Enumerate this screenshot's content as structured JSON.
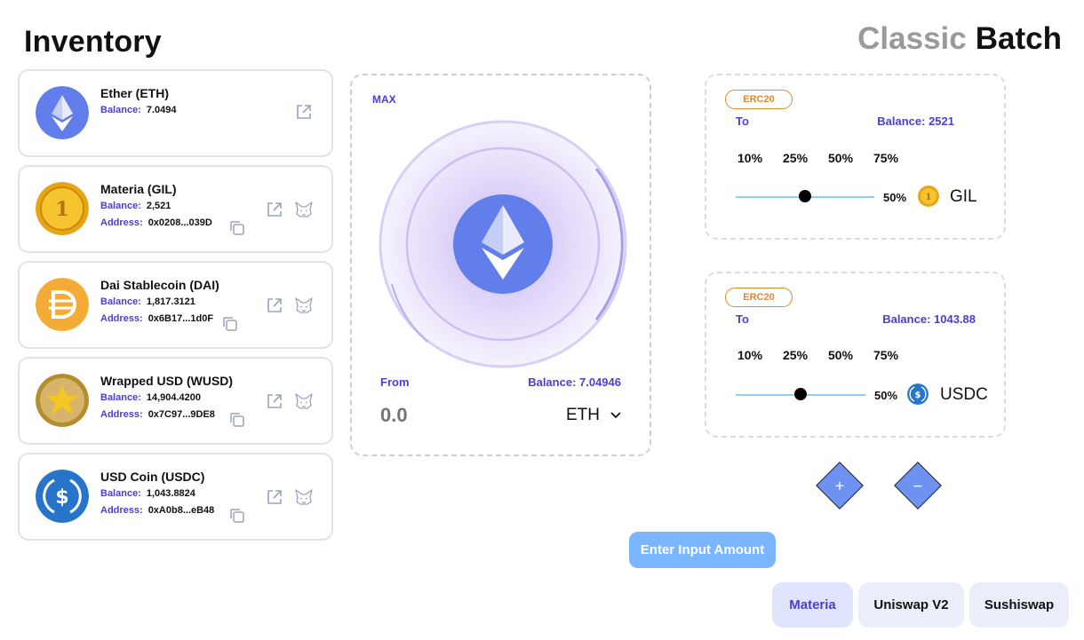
{
  "header": {
    "inventory_title": "Inventory",
    "mode_classic": "Classic",
    "mode_batch": "Batch"
  },
  "inventory": [
    {
      "name": "Ether (ETH)",
      "balance_label": "Balance:",
      "balance": "7.0494",
      "address_label": "",
      "address": "",
      "logo_color": "#627eea"
    },
    {
      "name": "Materia (GIL)",
      "balance_label": "Balance:",
      "balance": "2,521",
      "address_label": "Address:",
      "address": "0x0208...039D",
      "logo_color": "#f2b51c"
    },
    {
      "name": "Dai Stablecoin (DAI)",
      "balance_label": "Balance:",
      "balance": "1,817.3121",
      "address_label": "Address:",
      "address": "0x6B17...1d0F",
      "logo_color": "#f5ac37"
    },
    {
      "name": "Wrapped USD (WUSD)",
      "balance_label": "Balance:",
      "balance": "14,904.4200",
      "address_label": "Address:",
      "address": "0x7C97...9DE8",
      "logo_color": "#c9a13a"
    },
    {
      "name": "USD Coin (USDC)",
      "balance_label": "Balance:",
      "balance": "1,043.8824",
      "address_label": "Address:",
      "address": "0xA0b8...eB48",
      "logo_color": "#2775ca"
    }
  ],
  "swap_from": {
    "max_label": "MAX",
    "from_label": "From",
    "balance_text": "Balance: 7.04946",
    "amount_placeholder": "0.0",
    "token_symbol": "ETH"
  },
  "outputs": [
    {
      "badge": "ERC20",
      "to_label": "To",
      "balance_text": "Balance: 2521",
      "percents": [
        "10%",
        "25%",
        "50%",
        "75%"
      ],
      "slider_value": "50%",
      "slider_fraction": 0.5,
      "token_symbol": "GIL",
      "logo_color": "#f2b51c"
    },
    {
      "badge": "ERC20",
      "to_label": "To",
      "balance_text": "Balance: 1043.88",
      "percents": [
        "10%",
        "25%",
        "50%",
        "75%"
      ],
      "slider_value": "50%",
      "slider_fraction": 0.5,
      "token_symbol": "USDC",
      "logo_color": "#2775ca"
    }
  ],
  "controls": {
    "add_symbol": "+",
    "remove_symbol": "−",
    "submit_label": "Enter Input Amount"
  },
  "dex": {
    "options": [
      "Materia",
      "Uniswap V2",
      "Sushiswap"
    ],
    "active": "Materia"
  },
  "colors": {
    "accent": "#4b3fcf",
    "eth_blue": "#627eea",
    "submit_blue": "#79b6ff",
    "badge_orange": "#e08a2c",
    "slider_track": "#8fd0ef"
  }
}
